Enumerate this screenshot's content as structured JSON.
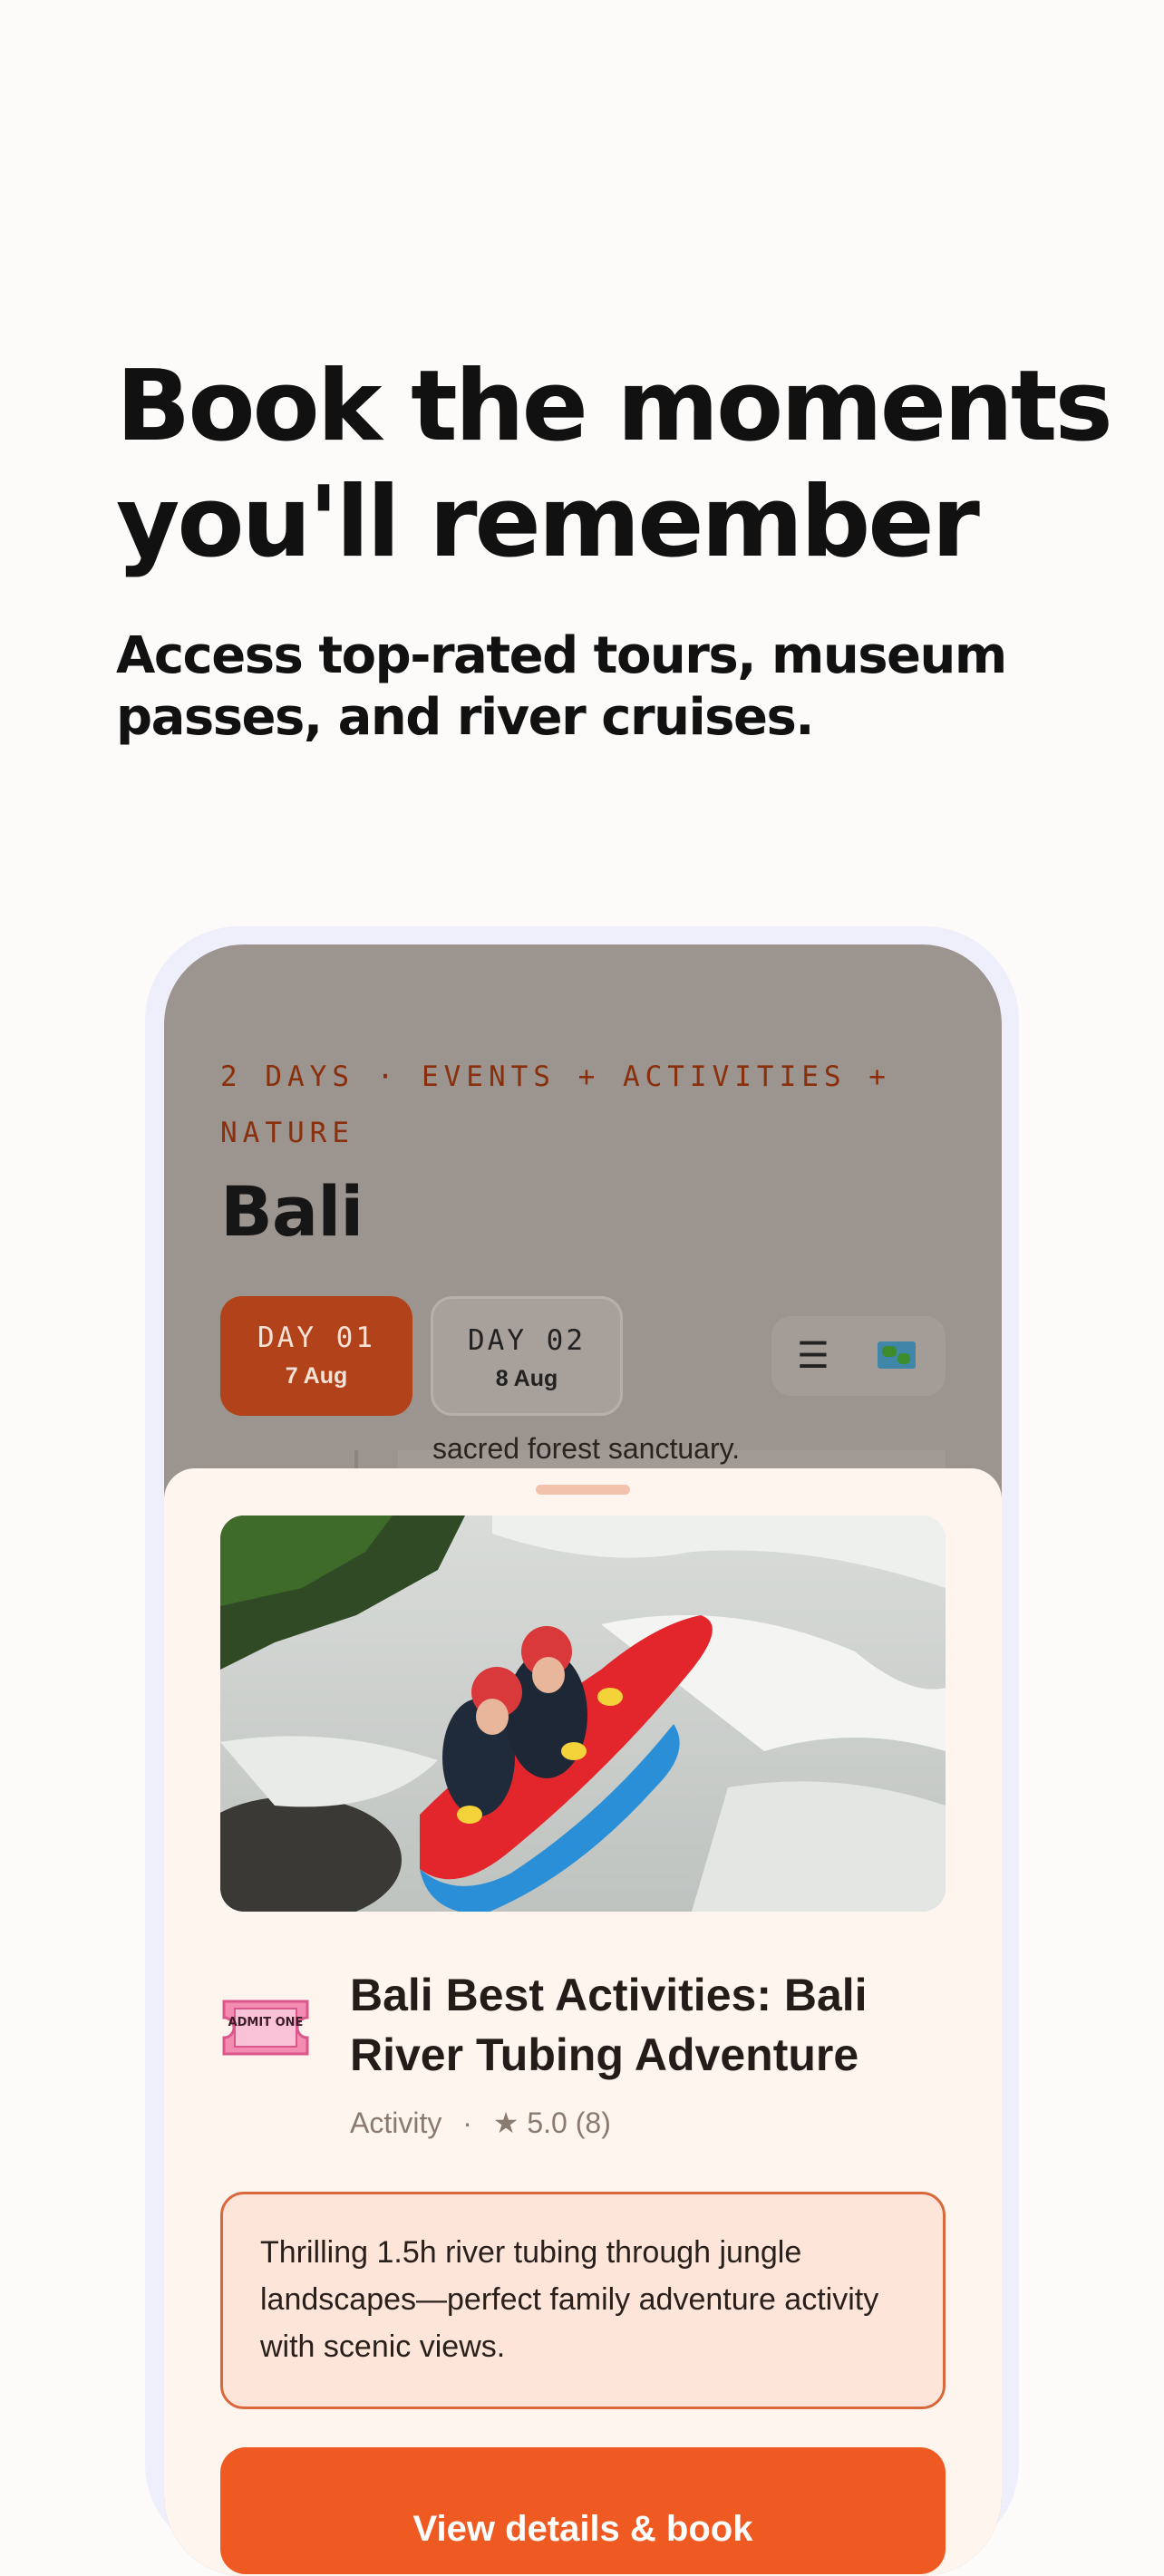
{
  "hero": {
    "headline": "Book the moments you'll remember",
    "subhead": "Access top-rated tours, museum passes, and river cruises."
  },
  "trip": {
    "eyebrow": "2 DAYS · EVENTS + ACTIVITIES + NATURE",
    "title": "Bali",
    "days": [
      {
        "label": "DAY 01",
        "date": "7 Aug",
        "selected": true
      },
      {
        "label": "DAY 02",
        "date": "8 Aug",
        "selected": false
      }
    ],
    "view_toggle": {
      "list_icon": "list-icon",
      "map_icon": "map-icon"
    },
    "peek_text": "sacred forest sanctuary."
  },
  "activity": {
    "photo_subject": "river-tubing-photo",
    "ticket_icon": "admit-one-ticket-icon",
    "ticket_text": "ADMIT ONE",
    "title": "Bali Best Activities: Bali River Tubing Adventure",
    "category": "Activity",
    "separator": "·",
    "rating": "★ 5.0 (8)",
    "description": "Thrilling 1.5h river tubing through jungle landscapes—perfect family adventure activity with scenic views.",
    "cta_label": "View details & book"
  },
  "colors": {
    "accent": "#ef5a22",
    "accent_dark": "#b2421a",
    "sheet_bg": "#fff5ef",
    "desc_bg": "#fde6d9",
    "desc_border": "#d9683c"
  }
}
